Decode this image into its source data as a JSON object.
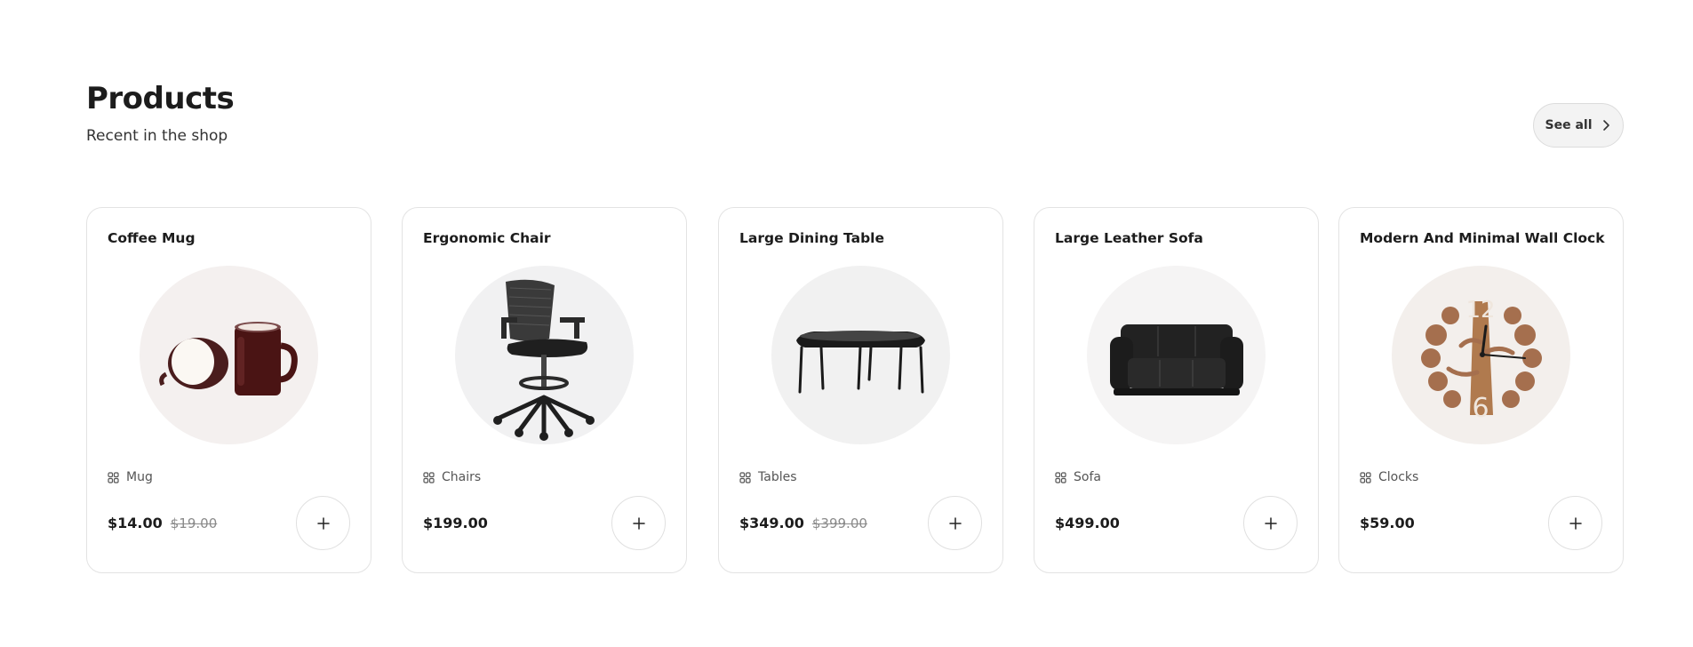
{
  "header": {
    "title": "Products",
    "subtitle": "Recent in the shop",
    "see_all_label": "See all"
  },
  "products": [
    {
      "name": "Coffee Mug",
      "category": "Mug",
      "price": "$14.00",
      "old_price": "$19.00",
      "bg": "#f4f0ef"
    },
    {
      "name": "Ergonomic Chair",
      "category": "Chairs",
      "price": "$199.00",
      "old_price": "",
      "bg": "#f1f1f2"
    },
    {
      "name": "Large Dining Table",
      "category": "Tables",
      "price": "$349.00",
      "old_price": "$399.00",
      "bg": "#f1f1f1"
    },
    {
      "name": "Large Leather Sofa",
      "category": "Sofa",
      "price": "$499.00",
      "old_price": "",
      "bg": "#f5f4f4"
    },
    {
      "name": "Modern And Minimal Wall Clock",
      "category": "Clocks",
      "price": "$59.00",
      "old_price": "",
      "bg": "#f3efec"
    }
  ],
  "icons": {
    "see_all": "chevron-right-icon",
    "category": "grid-icon",
    "add": "plus-icon"
  }
}
